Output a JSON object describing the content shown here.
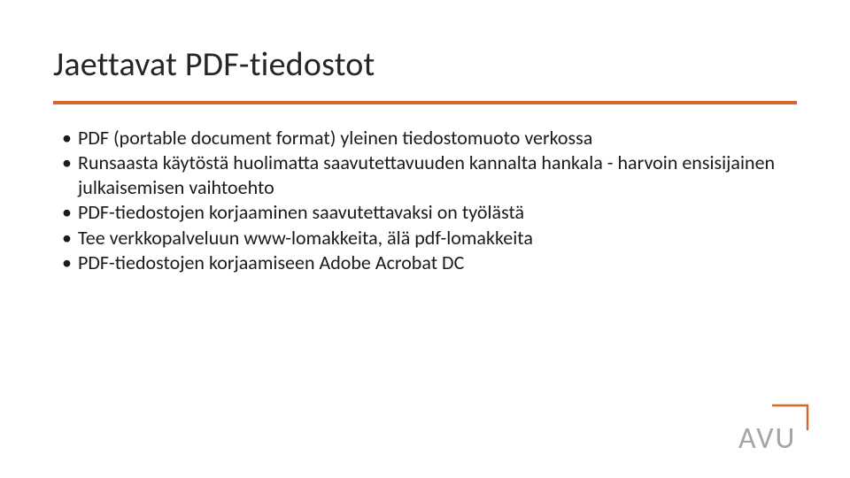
{
  "slide": {
    "title": "Jaettavat PDF-tiedostot",
    "bullets": [
      "PDF (portable document format) yleinen tiedostomuoto verkossa",
      "Runsaasta käytöstä huolimatta saavutettavuuden kannalta hankala - harvoin ensisijainen julkaisemisen vaihtoehto",
      "PDF-tiedostojen korjaaminen saavutettavaksi on työlästä",
      "Tee verkkopalveluun www-lomakkeita, älä pdf-lomakkeita",
      "PDF-tiedostojen korjaamiseen Adobe Acrobat DC"
    ]
  },
  "logo": {
    "text": "AVU"
  },
  "colors": {
    "accent": "#d9652a",
    "text": "#1a1a1a",
    "logoGray": "#a5a5a5"
  }
}
